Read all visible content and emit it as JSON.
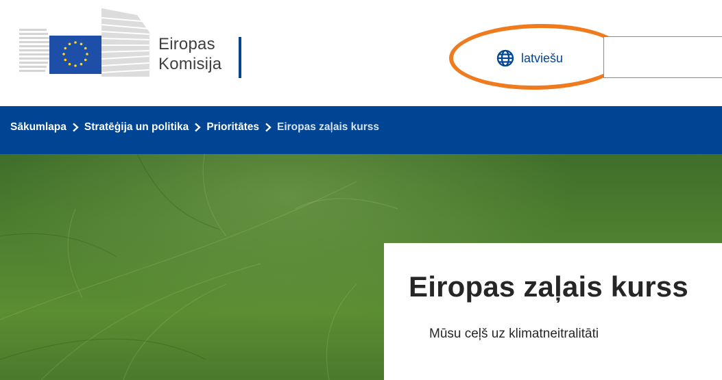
{
  "header": {
    "logo_line1": "Eiropas",
    "logo_line2": "Komisija",
    "language": "latviešu",
    "colors": {
      "brand_blue": "#004494",
      "annotation_orange": "#f07b1f"
    }
  },
  "breadcrumb": [
    {
      "label": "Sākumlapa"
    },
    {
      "label": "Stratēģija un politika"
    },
    {
      "label": "Prioritātes"
    },
    {
      "label": "Eiropas zaļais kurss"
    }
  ],
  "hero": {
    "title": "Eiropas zaļais kurss",
    "subtitle": "Mūsu ceļš uz klimatneitralitāti",
    "colors": {
      "accent_yellow": "#ffd617"
    }
  }
}
